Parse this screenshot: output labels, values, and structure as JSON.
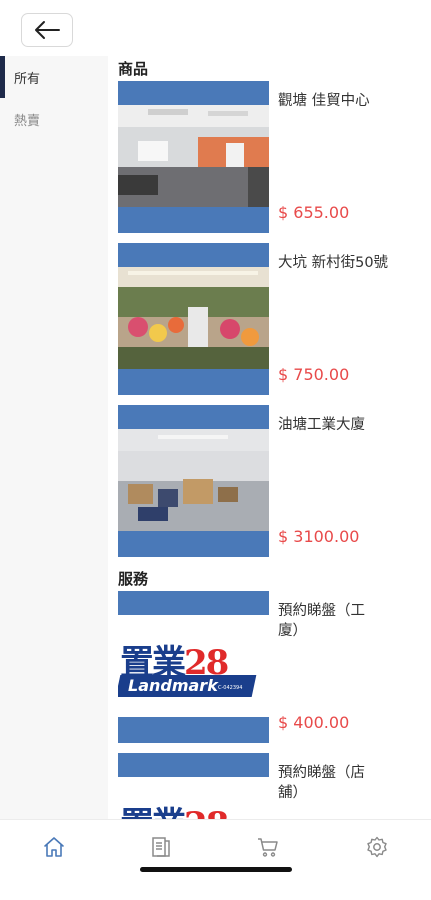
{
  "header": {
    "back_icon": "arrow-left-icon"
  },
  "sidebar": {
    "categories": [
      {
        "label": "所有",
        "active": true
      },
      {
        "label": "熱賣",
        "active": false
      }
    ]
  },
  "sections": [
    {
      "title": "商品",
      "items": [
        {
          "name": "觀塘 佳貿中心",
          "price": "$ 655.00",
          "image": "office-interior-photo"
        },
        {
          "name": "大坑 新村街50號",
          "price": "$ 750.00",
          "image": "flower-shop-photo"
        },
        {
          "name": "油塘工業大廈",
          "price": "$ 3100.00",
          "image": "warehouse-photo"
        }
      ]
    },
    {
      "title": "服務",
      "items": [
        {
          "name": "預約睇盤（工\n廈）",
          "price": "$ 400.00",
          "image": "landmark-logo"
        },
        {
          "name": "預約睇盤（店\n舖）",
          "price": "",
          "image": "landmark-logo"
        }
      ]
    }
  ],
  "logo": {
    "main": "置業",
    "number": "28",
    "band": "Landmark",
    "license": "C-042394"
  },
  "tabbar": [
    {
      "icon": "home-icon",
      "active": true
    },
    {
      "icon": "document-icon",
      "active": false
    },
    {
      "icon": "cart-icon",
      "active": false
    },
    {
      "icon": "gear-icon",
      "active": false
    }
  ],
  "colors": {
    "accent": "#4a79b8",
    "price": "#e84a4a",
    "active_tab": "#4a79b8",
    "sidebar_marker": "#1e2a4a"
  }
}
